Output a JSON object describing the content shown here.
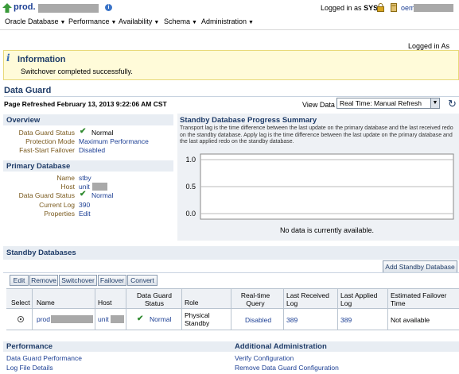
{
  "header": {
    "target_name": "prod.",
    "logged_in_as": "Logged in as",
    "user": "SYS",
    "oem_prefix": "oem",
    "logged_in_as_2": "Logged in As SYS"
  },
  "menu": [
    {
      "label": "Oracle Database"
    },
    {
      "label": "Performance"
    },
    {
      "label": "Availability"
    },
    {
      "label": "Schema"
    },
    {
      "label": "Administration"
    }
  ],
  "information": {
    "title": "Information",
    "message": "Switchover completed successfully."
  },
  "page": {
    "title": "Data Guard",
    "refreshed": "Page Refreshed February 13, 2013 9:22:06 AM CST",
    "view_data_label": "View Data",
    "view_data_value": "Real Time: Manual Refresh"
  },
  "overview": {
    "heading": "Overview",
    "status_label": "Data Guard Status",
    "status_value": "Normal",
    "protection_label": "Protection Mode",
    "protection_value": "Maximum Performance",
    "fsfo_label": "Fast-Start Failover",
    "fsfo_value": "Disabled"
  },
  "primary": {
    "heading": "Primary Database",
    "name_label": "Name",
    "name_value": "stby",
    "host_label": "Host",
    "host_value": "unit",
    "status_label": "Data Guard Status",
    "status_value": "Normal",
    "log_label": "Current Log",
    "log_value": "390",
    "props_label": "Properties",
    "props_value": "Edit"
  },
  "progress": {
    "heading": "Standby Database Progress Summary",
    "description": "Transport lag is the time difference between the last update on the primary database and the last received redo on the standby database. Apply lag is the time difference between the last update on the primary database and the last applied redo on the standby database.",
    "no_data": "No data is currently available."
  },
  "chart_data": {
    "type": "bar",
    "title": "",
    "xlabel": "",
    "ylabel": "",
    "ylim": [
      0,
      1
    ],
    "y_ticks": [
      "1.0",
      "0.5",
      "0.0"
    ],
    "categories": [],
    "values": []
  },
  "standby": {
    "heading": "Standby Databases",
    "add_button": "Add Standby Database",
    "buttons": [
      "Edit",
      "Remove",
      "Switchover",
      "Failover",
      "Convert"
    ],
    "columns": [
      "Select",
      "Name",
      "Host",
      "Data Guard Status",
      "Role",
      "Real-time Query",
      "Last Received Log",
      "Last Applied Log",
      "Estimated Failover Time"
    ],
    "row": {
      "name": "prod",
      "host": "unit",
      "status": "Normal",
      "role": "Physical Standby",
      "realtime_query": "Disabled",
      "last_received": "389",
      "last_applied": "389",
      "failover_time": "Not available"
    }
  },
  "performance": {
    "heading": "Performance",
    "links": [
      "Data Guard Performance",
      "Log File Details"
    ]
  },
  "additional": {
    "heading": "Additional Administration",
    "links": [
      "Verify Configuration",
      "Remove Data Guard Configuration"
    ]
  },
  "colors": {
    "link": "#1c3f94",
    "heading": "#1f3c68",
    "ok_check": "#2f8a2f",
    "info_bg": "#fffbd9"
  }
}
